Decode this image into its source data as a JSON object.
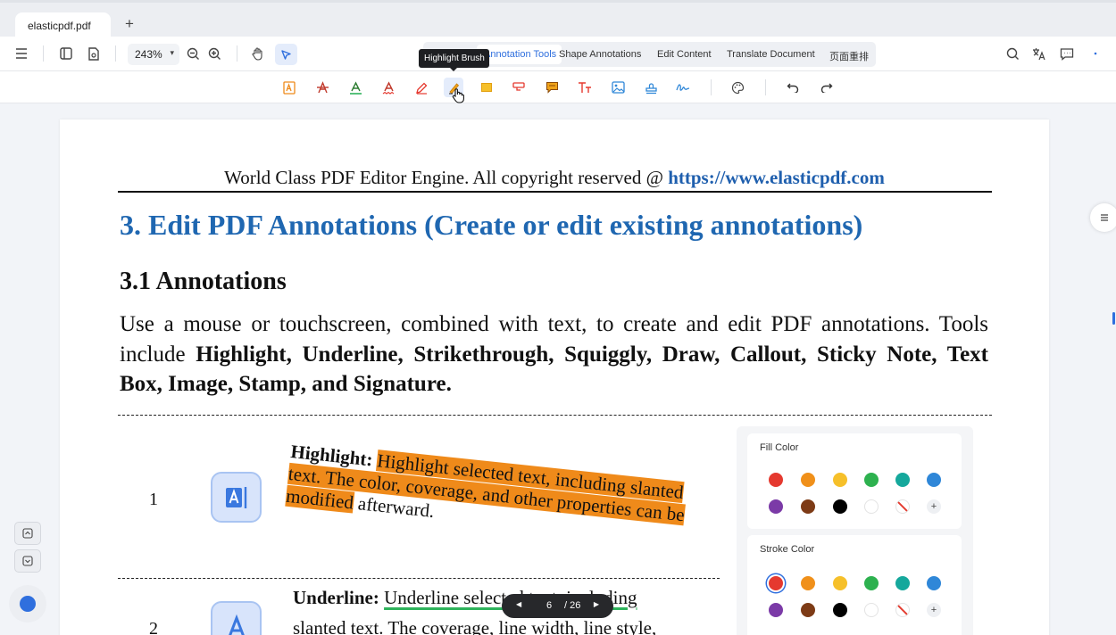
{
  "tabs": [
    {
      "label": "elasticpdf.pdf"
    }
  ],
  "new_tab_label": "+",
  "toolbar": {
    "zoom": "243%",
    "modes": [
      {
        "label": "Annotation Tools",
        "active": true
      },
      {
        "label": "Shape Annotations"
      },
      {
        "label": "Edit Content"
      },
      {
        "label": "Translate Document"
      },
      {
        "label": "页面重排"
      }
    ],
    "tooltip": "Highlight Brush"
  },
  "document": {
    "header_text": "World Class PDF Editor Engine. All copyright reserved @",
    "header_link": "https://www.elasticpdf.com",
    "h1": "3.  Edit PDF Annotations (Create or edit existing annotations)",
    "h2": "3.1 Annotations",
    "para_intro": "Use a mouse or touchscreen, combined with text, to create and edit PDF annotations. Tools include ",
    "para_bold": "Highlight, Underline, Strikethrough, Squiggly, Draw, Callout, Sticky Note, Text Box, Image, Stamp, and Signature.",
    "rows": [
      {
        "num": "1",
        "label": "Highlight:",
        "text_hl1": "Highlight selected text, including slanted",
        "text_hl2": "text. The color, coverage, and other properties can be",
        "text_hl3": "modified",
        "text_tail": " afterward."
      },
      {
        "num": "2",
        "label": "Underline:",
        "text_ul": "Underline selected text, including",
        "text_next": "slanted text. The coverage, line width, line style,"
      }
    ]
  },
  "color_panel": {
    "fill_title": "Fill Color",
    "stroke_title": "Stroke Color",
    "swatches": [
      "#e5392f",
      "#f0901a",
      "#f6c02a",
      "#2db14f",
      "#15a89c",
      "#2f87d8",
      "#7b3aa7",
      "#7d3b16",
      "#000000",
      "#ffffff",
      "none",
      "+"
    ],
    "add_label": "+",
    "stroke_selected": "#e5392f"
  },
  "pager": {
    "prev": "◀",
    "current": "6",
    "total": "/ 26",
    "next": "▶"
  },
  "colors": {
    "accent": "#2f6fde",
    "highlight": "#ef8a1a",
    "heading": "#1f67b1",
    "underline": "#2fb35c"
  }
}
